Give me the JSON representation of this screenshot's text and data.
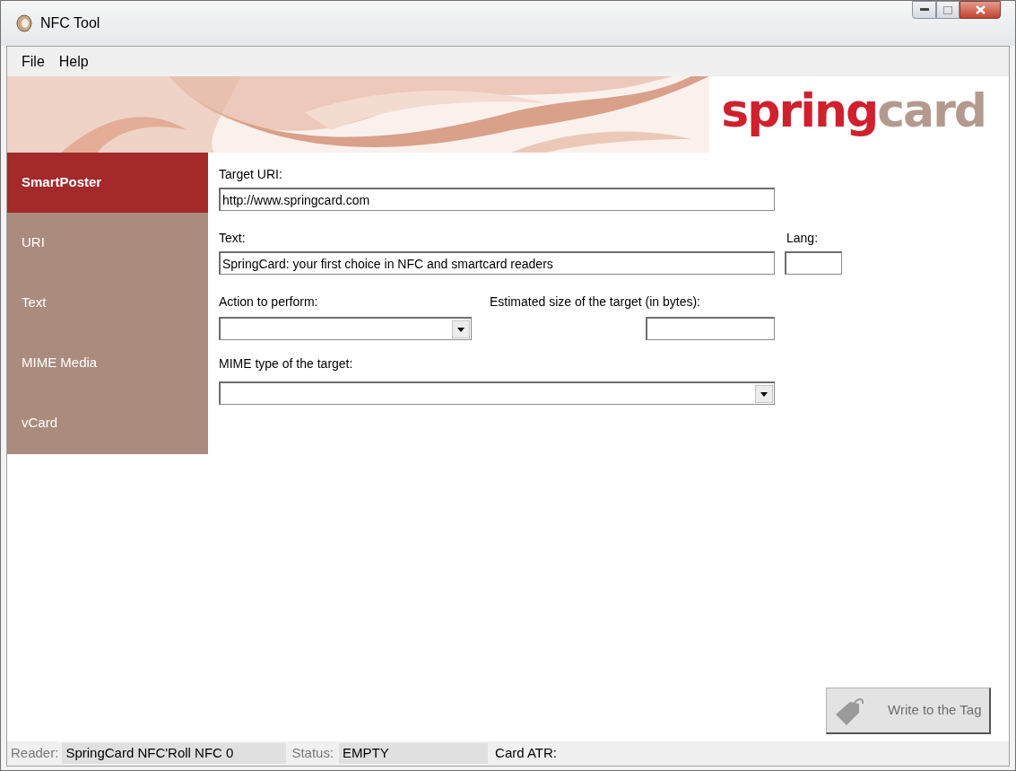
{
  "window": {
    "title": "NFC Tool"
  },
  "menu": [
    "File",
    "Help"
  ],
  "banner": {
    "kind": "picture",
    "logo": [
      {
        "text": "spring",
        "color": "#d0202e"
      },
      {
        "text": "card",
        "color": "#b49a8e"
      }
    ]
  },
  "sidebar": {
    "items": [
      {
        "label": "SmartPoster",
        "selected": true
      },
      {
        "label": "URI",
        "selected": false
      },
      {
        "label": "Text",
        "selected": false
      },
      {
        "label": "MIME Media",
        "selected": false
      },
      {
        "label": "vCard",
        "selected": false
      }
    ]
  },
  "form": {
    "target_uri": {
      "label": "Target URI:",
      "value": "http://www.springcard.com"
    },
    "text": {
      "label": "Text:",
      "value": "SpringCard: your first choice in NFC and smartcard readers"
    },
    "lang": {
      "label": "Lang:"
    },
    "action": {
      "label": "Action to perform:"
    },
    "estimated_size": {
      "label": "Estimated size of the target (in bytes):"
    },
    "mime_type": {
      "label": "MIME type of the target:"
    }
  },
  "write_button": {
    "label": "Write to the Tag",
    "disabled": true
  },
  "status_bar": {
    "reader_label": "Reader:",
    "reader": "SpringCard NFC'Roll NFC 0",
    "status_label": "Status:",
    "status": "EMPTY",
    "atr_label": "Card ATR:"
  }
}
